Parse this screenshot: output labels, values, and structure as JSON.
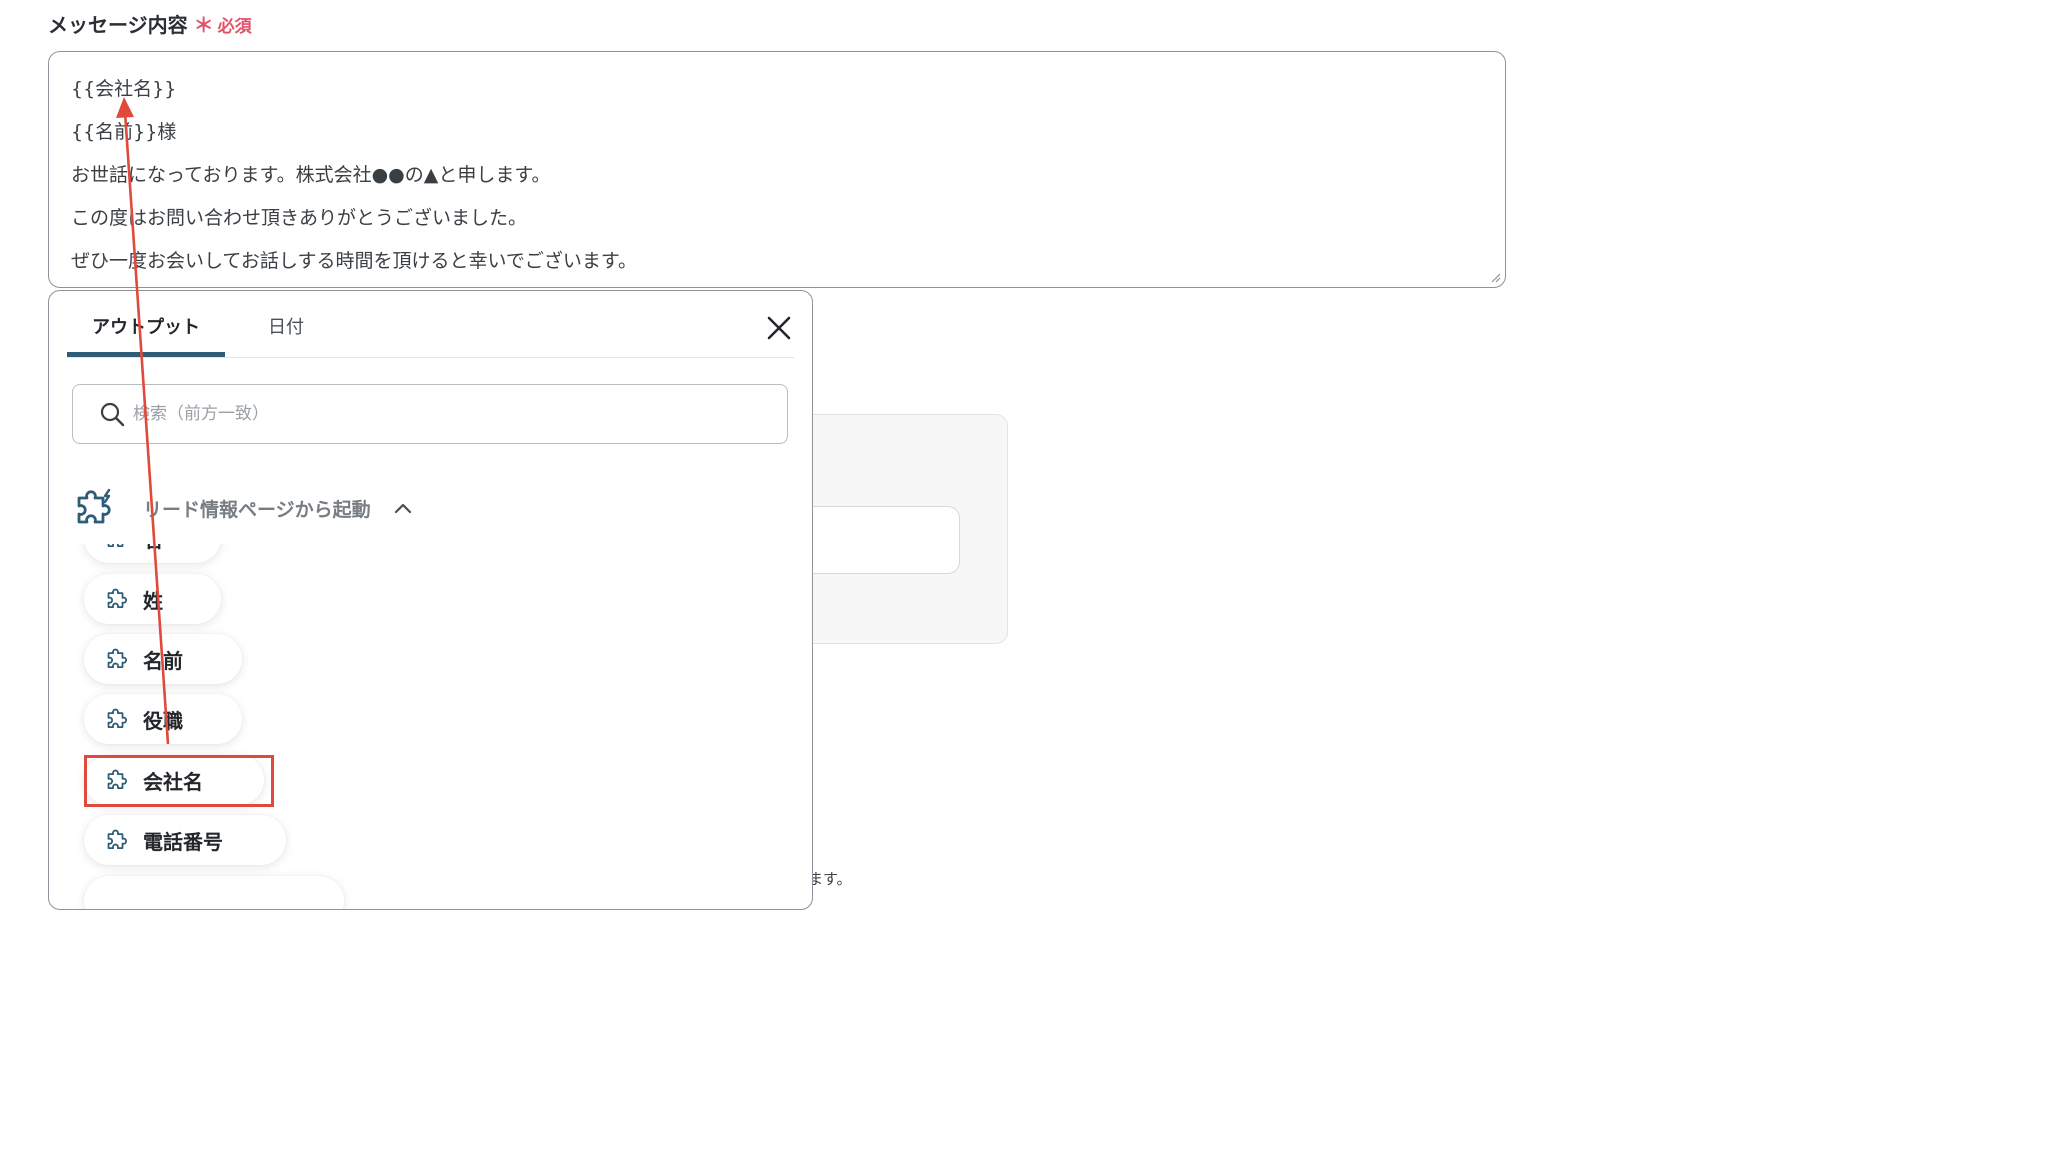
{
  "field": {
    "label": "メッセージ内容",
    "required_mark": "＊",
    "required_text": "必須"
  },
  "message": {
    "lines": [
      "{{会社名}}",
      "{{名前}}様",
      "お世話になっております。株式会社●●の▲と申します。",
      "この度はお問い合わせ頂きありがとうございました。",
      "ぜひ一度お会いしてお話しする時間を頂けると幸いでございます。"
    ]
  },
  "popover": {
    "tabs": [
      {
        "label": "アウトプット",
        "active": true
      },
      {
        "label": "日付",
        "active": false
      }
    ],
    "close_icon": "close-icon",
    "search": {
      "placeholder": "検索（前方一致）",
      "value": ""
    },
    "section": {
      "title": "リード情報ページから起動",
      "icon": "puzzle-icon",
      "expanded": true
    },
    "items": [
      {
        "label": "名"
      },
      {
        "label": "姓"
      },
      {
        "label": "名前"
      },
      {
        "label": "役職"
      },
      {
        "label": "会社名",
        "highlighted": true
      },
      {
        "label": "電話番号"
      },
      {
        "label": ""
      }
    ]
  },
  "background": {
    "partial_text": "ます。"
  },
  "colors": {
    "accent_tab": "#2f5d78",
    "required": "#e2536a",
    "annotation": "#e0493b"
  }
}
